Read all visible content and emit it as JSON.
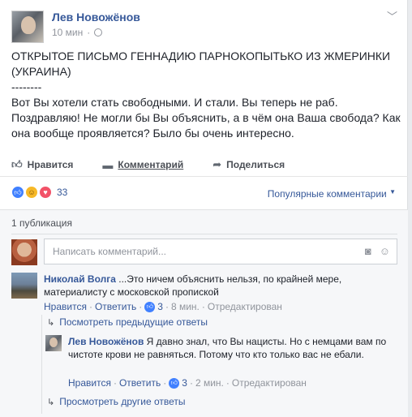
{
  "post": {
    "author": "Лев Новожёнов",
    "time": "10 мин",
    "text": "ОТКРЫТОЕ ПИСЬМО ГЕННАДИЮ ПАРНОКОПЫТЬКО ИЗ ЖМЕРИНКИ (УКРАИНА)\n--------\nВот Вы хотели стать свободными. И стали. Вы теперь не раб. Поздравляю! Не могли бы Вы объяснить, а в чём она Ваша свобода? Как она вообще проявляется? Было бы очень интересно.",
    "actions": {
      "like": "Нравится",
      "comment": "Комментарий",
      "share": "Поделиться"
    },
    "reactions_count": "33",
    "sort_label": "Популярные комментарии"
  },
  "comments_area": {
    "publications": "1 публикация",
    "input_placeholder": "Написать комментарий..."
  },
  "comments": [
    {
      "author": "Николай Волга",
      "text": "...Это ничем объяснить нельзя, по крайней мере, материалисту с московской пропиской",
      "like_label": "Нравится",
      "reply_label": "Ответить",
      "likes": "3",
      "time": "8 мин.",
      "edited": "Отредактирован"
    },
    {
      "author": "Лев Новожёнов",
      "text": "Я давно знал, что Вы нацисты. Но с немцами вам по чистоте крови не равняться. Потому что кто только вас не ебали.",
      "like_label": "Нравится",
      "reply_label": "Ответить",
      "likes": "3",
      "time": "2 мин.",
      "edited": "Отредактирован"
    }
  ],
  "links": {
    "prev_replies": "Посмотреть предыдущие ответы",
    "other_replies": "Просмотреть другие ответы"
  },
  "colors": {
    "link": "#365899",
    "meta": "#90949c",
    "like": "#4080ff",
    "haha": "#f7b928",
    "love": "#f25268"
  }
}
